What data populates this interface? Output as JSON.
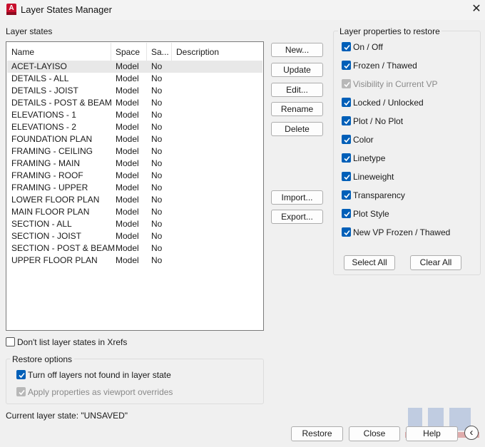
{
  "window": {
    "title": "Layer States Manager",
    "close_glyph": "✕",
    "app_icon_letter": "A"
  },
  "layer_states": {
    "group_label": "Layer states",
    "columns": [
      "Name",
      "Space",
      "Sa...",
      "Description"
    ],
    "rows": [
      {
        "name": "ACET-LAYISO",
        "space": "Model",
        "saved": "No",
        "description": ""
      },
      {
        "name": "DETAILS - ALL",
        "space": "Model",
        "saved": "No",
        "description": ""
      },
      {
        "name": "DETAILS - JOIST",
        "space": "Model",
        "saved": "No",
        "description": ""
      },
      {
        "name": "DETAILS - POST & BEAM",
        "space": "Model",
        "saved": "No",
        "description": ""
      },
      {
        "name": "ELEVATIONS - 1",
        "space": "Model",
        "saved": "No",
        "description": ""
      },
      {
        "name": "ELEVATIONS - 2",
        "space": "Model",
        "saved": "No",
        "description": ""
      },
      {
        "name": "FOUNDATION PLAN",
        "space": "Model",
        "saved": "No",
        "description": ""
      },
      {
        "name": "FRAMING - CEILING",
        "space": "Model",
        "saved": "No",
        "description": ""
      },
      {
        "name": "FRAMING - MAIN",
        "space": "Model",
        "saved": "No",
        "description": ""
      },
      {
        "name": "FRAMING - ROOF",
        "space": "Model",
        "saved": "No",
        "description": ""
      },
      {
        "name": "FRAMING - UPPER",
        "space": "Model",
        "saved": "No",
        "description": ""
      },
      {
        "name": "LOWER FLOOR PLAN",
        "space": "Model",
        "saved": "No",
        "description": ""
      },
      {
        "name": "MAIN FLOOR PLAN",
        "space": "Model",
        "saved": "No",
        "description": ""
      },
      {
        "name": "SECTION - ALL",
        "space": "Model",
        "saved": "No",
        "description": ""
      },
      {
        "name": "SECTION - JOIST",
        "space": "Model",
        "saved": "No",
        "description": ""
      },
      {
        "name": "SECTION - POST & BEAM",
        "space": "Model",
        "saved": "No",
        "description": ""
      },
      {
        "name": "UPPER FLOOR PLAN",
        "space": "Model",
        "saved": "No",
        "description": ""
      }
    ],
    "selected_index": 0
  },
  "actions": {
    "new": "New...",
    "update": "Update",
    "edit": "Edit...",
    "rename": "Rename",
    "delete": "Delete",
    "import": "Import...",
    "export": "Export..."
  },
  "xrefs_option": {
    "label": "Don't list layer states in Xrefs",
    "checked": false
  },
  "restore_options": {
    "group_label": "Restore options",
    "turn_off": {
      "label": "Turn off layers not found in layer state",
      "checked": true
    },
    "apply_vp": {
      "label": "Apply properties as viewport overrides",
      "checked": true,
      "disabled": true
    }
  },
  "properties": {
    "group_label": "Layer properties to restore",
    "items": [
      {
        "label": "On / Off",
        "checked": true,
        "disabled": false
      },
      {
        "label": "Frozen / Thawed",
        "checked": true,
        "disabled": false
      },
      {
        "label": "Visibility in Current VP",
        "checked": true,
        "disabled": true
      },
      {
        "label": "Locked / Unlocked",
        "checked": true,
        "disabled": false
      },
      {
        "label": "Plot / No Plot",
        "checked": true,
        "disabled": false
      },
      {
        "label": "Color",
        "checked": true,
        "disabled": false
      },
      {
        "label": "Linetype",
        "checked": true,
        "disabled": false
      },
      {
        "label": "Lineweight",
        "checked": true,
        "disabled": false
      },
      {
        "label": "Transparency",
        "checked": true,
        "disabled": false
      },
      {
        "label": "Plot Style",
        "checked": true,
        "disabled": false
      },
      {
        "label": "New VP Frozen / Thawed",
        "checked": true,
        "disabled": false
      }
    ],
    "select_all": "Select All",
    "clear_all": "Clear All"
  },
  "status": {
    "current_state": "Current layer state: \"UNSAVED\""
  },
  "footer": {
    "restore": "Restore",
    "close": "Close",
    "help": "Help",
    "collapse_glyph": "‹"
  },
  "colors": {
    "accent": "#005fb8",
    "selection": "#e8e8e8",
    "brand": "#c8102e"
  }
}
